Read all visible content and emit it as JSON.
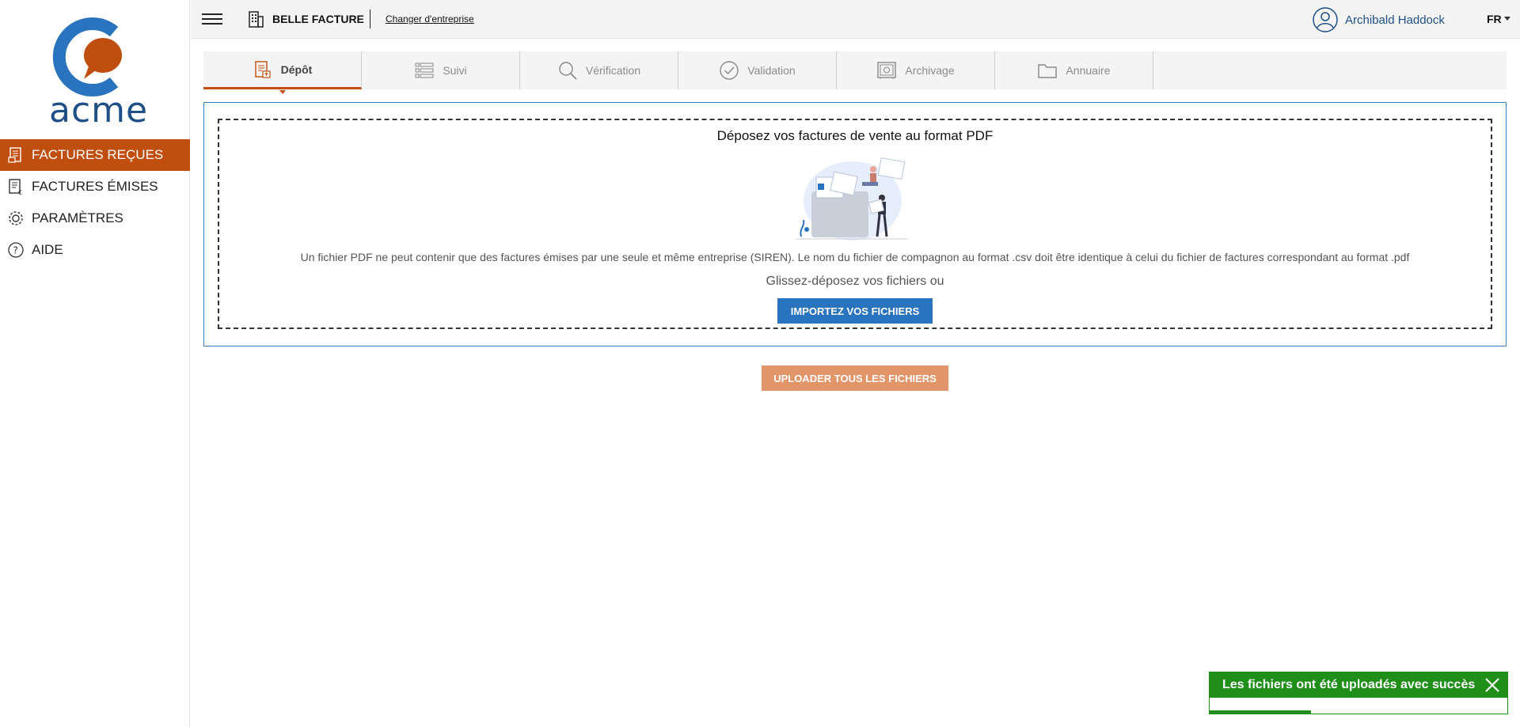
{
  "brand": {
    "logo_text": "acme",
    "accent": "#c04e0e",
    "primary": "#1e4f86"
  },
  "sidebar": {
    "items": [
      {
        "label": "FACTURES REÇUES",
        "icon": "invoice-received-icon",
        "active": true
      },
      {
        "label": "FACTURES ÉMISES",
        "icon": "invoice-sent-icon",
        "active": false
      },
      {
        "label": "PARAMÈTRES",
        "icon": "gear-icon",
        "active": false
      },
      {
        "label": "AIDE",
        "icon": "help-icon",
        "active": false
      }
    ]
  },
  "topbar": {
    "company_name": "BELLE FACTURE",
    "change_company": "Changer d'entreprise",
    "user_name": "Archibald Haddock",
    "language": "FR"
  },
  "tabs": [
    {
      "label": "Dépôt",
      "icon": "deposit-icon",
      "active": true
    },
    {
      "label": "Suivi",
      "icon": "list-icon",
      "active": false
    },
    {
      "label": "Vérification",
      "icon": "search-icon",
      "active": false
    },
    {
      "label": "Validation",
      "icon": "check-circle-icon",
      "active": false
    },
    {
      "label": "Archivage",
      "icon": "safe-icon",
      "active": false
    },
    {
      "label": "Annuaire",
      "icon": "folder-icon",
      "active": false
    }
  ],
  "dropzone": {
    "title": "Déposez vos factures de vente au format PDF",
    "info": "Un fichier PDF ne peut contenir que des factures émises par une seule et même entreprise (SIREN). Le nom du fichier de compagnon au format .csv doit être identique à celui du fichier de factures correspondant au format .pdf",
    "drag_text": "Glissez-déposez vos fichiers ou",
    "import_button": "IMPORTEZ VOS FICHIERS"
  },
  "upload_button": "UPLOADER TOUS LES FICHIERS",
  "toast": {
    "message": "Les fichiers ont été uploadés avec succès",
    "progress": 0.34,
    "color": "#1f8f1a"
  }
}
